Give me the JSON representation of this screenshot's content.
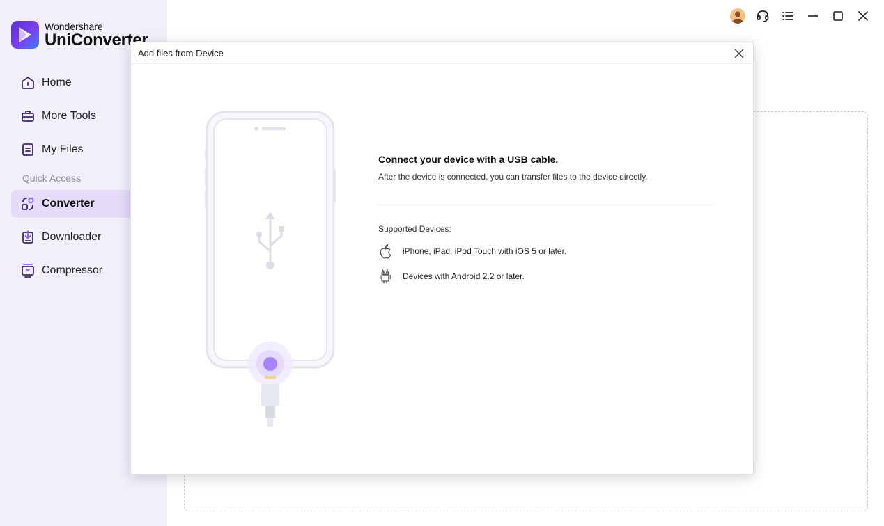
{
  "app": {
    "brand_small": "Wondershare",
    "brand_big": "UniConverter"
  },
  "sidebar": {
    "items": [
      {
        "label": "Home",
        "icon": "home-icon"
      },
      {
        "label": "More Tools",
        "icon": "toolbox-icon"
      },
      {
        "label": "My Files",
        "icon": "files-icon"
      }
    ],
    "section_label": "Quick Access",
    "quick_access": [
      {
        "label": "Converter",
        "icon": "converter-icon",
        "active": true
      },
      {
        "label": "Downloader",
        "icon": "downloader-icon"
      },
      {
        "label": "Compressor",
        "icon": "compressor-icon"
      }
    ]
  },
  "titlebar": {
    "icons": [
      "avatar-icon",
      "headset-icon",
      "menu-list-icon",
      "minimize-icon",
      "maximize-icon",
      "close-icon"
    ]
  },
  "dialog": {
    "title": "Add files from Device",
    "heading": "Connect your device with a USB cable.",
    "description": "After the device is connected, you can transfer files to the device directly.",
    "supported_label": "Supported Devices:",
    "devices": [
      {
        "icon": "apple-icon",
        "text": "iPhone, iPad, iPod Touch with iOS 5 or later."
      },
      {
        "icon": "android-icon",
        "text": "Devices with Android 2.2 or later."
      }
    ]
  },
  "colors": {
    "sidebar_bg": "#f2effb",
    "active_item_bg": "#e4dcf9",
    "accent": "#7c4dff",
    "icon_stroke": "#3b2a6b"
  }
}
